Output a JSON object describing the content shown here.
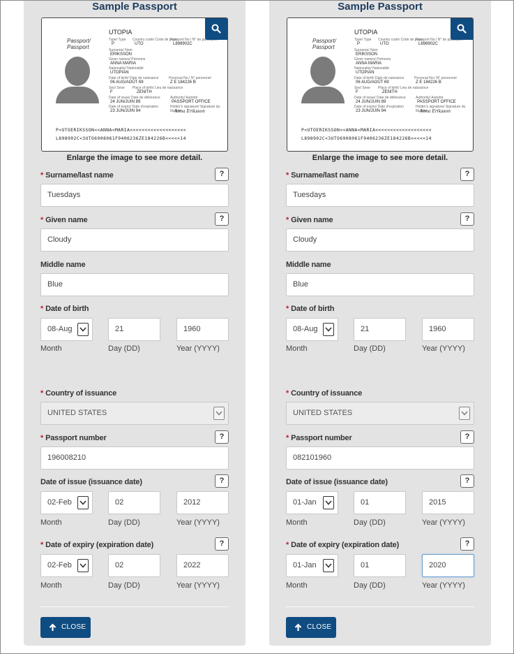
{
  "panels": [
    {
      "title": "Sample Passport",
      "passport": {
        "label1": "Passport/",
        "label2": "Passport",
        "country": "UTOPIA",
        "type_label": "Type/ Type",
        "type": "P",
        "code_label": "Country code/ Code de pays",
        "code": "UTO",
        "number_label": "Passport No./ N° de passeport",
        "number": "L898902C",
        "surname_label": "Surname/ Nom",
        "surname": "ERIKSSON",
        "given_label": "Given names/ Prénoms",
        "given": "ANNA MARIA",
        "nationality_label": "Nationality/ Nationalité",
        "nationality": "UTOPIAN",
        "dob_label": "Date of birth/ Date de naissance",
        "dob": "06 AUG/AOÛT 69",
        "personal_label": "Personal No./ N° personnel",
        "personal": "Z E 184226 B",
        "sex_label": "Sex/ Sexe",
        "sex": "F",
        "pob_label": "Place of birth/ Lieu de naissance",
        "pob": "ZENITH",
        "issue_label": "Date of issue/ Date de délivrance",
        "issue": "24 JUN/JUIN 89",
        "authority_label": "Authority/ Autorité",
        "authority": "PASSPORT OFFICE",
        "expiry_label": "Date of expiry/ Date d'expiration",
        "expiry": "23 JUN/JUIN 94",
        "holder_label": "Holder's signature/ Signature du titulaire",
        "signature": "Anna Eriksson",
        "mrz1": "P<UTOERIKSSON<<ANNA<MARIA<<<<<<<<<<<<<<<<<<<",
        "mrz2": "L898902C<3UTO6908061F9406236ZE184226B<<<<<14"
      },
      "enlarge_text": "Enlarge the image to see more detail.",
      "surname_label": "Surname/last name",
      "surname_value": "Tuesdays",
      "given_label": "Given name",
      "given_value": "Cloudy",
      "middle_label": "Middle name",
      "middle_value": "Blue",
      "dob_label": "Date of birth",
      "dob_month": "08-Aug",
      "dob_day": "21",
      "dob_year": "1960",
      "month_label": "Month",
      "day_label": "Day (DD)",
      "year_label": "Year (YYYY)",
      "country_label": "Country of issuance",
      "country_value": "UNITED STATES",
      "passport_label": "Passport number",
      "passport_value": "196008210",
      "issue_label": "Date of issue (issuance date)",
      "issue_month": "02-Feb",
      "issue_day": "02",
      "issue_year": "2012",
      "expiry_label": "Date of expiry (expiration date)",
      "expiry_month": "02-Feb",
      "expiry_day": "02",
      "expiry_year": "2022",
      "help": "?",
      "close_label": "CLOSE"
    },
    {
      "title": "Sample Passport",
      "passport": {
        "label1": "Passport/",
        "label2": "Passport",
        "country": "UTOPIA",
        "type_label": "Type/ Type",
        "type": "P",
        "code_label": "Country code/ Code de pays",
        "code": "UTO",
        "number_label": "Passport No./ N° de passeport",
        "number": "L898902C",
        "surname_label": "Surname/ Nom",
        "surname": "ERIKSSON",
        "given_label": "Given names/ Prénoms",
        "given": "ANNA MARIA",
        "nationality_label": "Nationality/ Nationalité",
        "nationality": "UTOPIAN",
        "dob_label": "Date of birth/ Date de naissance",
        "dob": "06 AUG/AOÛT 69",
        "personal_label": "Personal No./ N° personnel",
        "personal": "Z E 184226 B",
        "sex_label": "Sex/ Sexe",
        "sex": "F",
        "pob_label": "Place of birth/ Lieu de naissance",
        "pob": "ZENITH",
        "issue_label": "Date of issue/ Date de délivrance",
        "issue": "24 JUN/JUIN 89",
        "authority_label": "Authority/ Autorité",
        "authority": "PASSPORT OFFICE",
        "expiry_label": "Date of expiry/ Date d'expiration",
        "expiry": "23 JUN/JUIN 94",
        "holder_label": "Holder's signature/ Signature du titulaire",
        "signature": "Anna Eriksson",
        "mrz1": "P<UTOERIKSSON<<ANNA<MARIA<<<<<<<<<<<<<<<<<<<",
        "mrz2": "L898902C<3UTO6908061F9406236ZE184226B<<<<<14"
      },
      "enlarge_text": "Enlarge the image to see more detail.",
      "surname_label": "Surname/last name",
      "surname_value": "Tuesdays",
      "given_label": "Given name",
      "given_value": "Cloudy",
      "middle_label": "Middle name",
      "middle_value": "Blue",
      "dob_label": "Date of birth",
      "dob_month": "08-Aug",
      "dob_day": "21",
      "dob_year": "1960",
      "month_label": "Month",
      "day_label": "Day (DD)",
      "year_label": "Year (YYYY)",
      "country_label": "Country of issuance",
      "country_value": "UNITED STATES",
      "passport_label": "Passport number",
      "passport_value": "082101960",
      "issue_label": "Date of issue (issuance date)",
      "issue_month": "01-Jan",
      "issue_day": "01",
      "issue_year": "2015",
      "expiry_label": "Date of expiry (expiration date)",
      "expiry_month": "01-Jan",
      "expiry_day": "01",
      "expiry_year": "2020",
      "help": "?",
      "close_label": "CLOSE"
    }
  ],
  "required_marker": "*",
  "colors": {
    "brand": "#0f4c81",
    "title": "#1f3e60",
    "required": "#c0202a",
    "panel_bg": "#e3e3e3"
  },
  "icons": {
    "zoom": "search-icon",
    "close": "arrow-up-icon",
    "caret": "chevron-down-icon"
  }
}
